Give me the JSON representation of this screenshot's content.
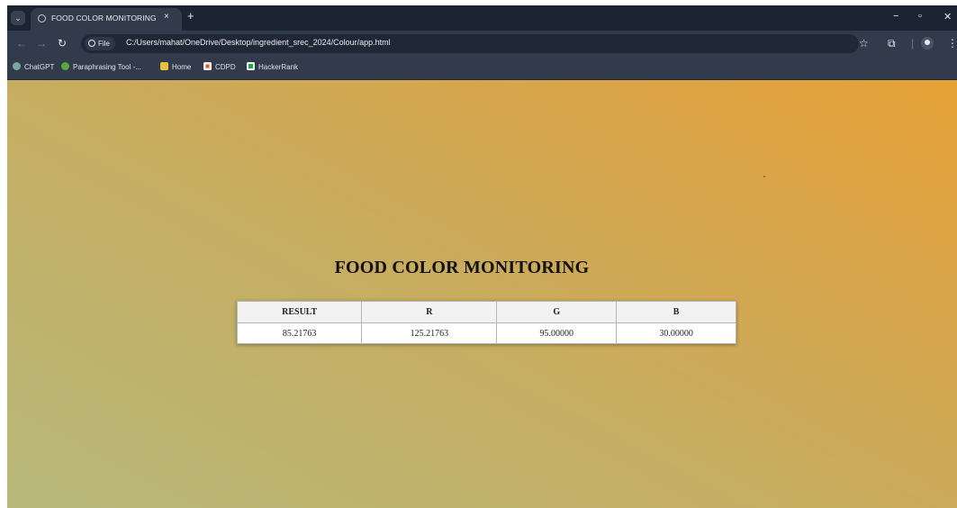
{
  "browser": {
    "tab_title": "FOOD COLOR MONITORING",
    "tab_close": "×",
    "new_tab": "+",
    "omnibox": {
      "info_label": "File",
      "url": "C:/Users/mahat/OneDrive/Desktop/ingredient_srec_2024/Colour/app.html"
    },
    "bookmarks": [
      {
        "label": "ChatGPT",
        "color": "#74aa9c"
      },
      {
        "label": "Paraphrasing Tool -...",
        "color": "#5da545"
      },
      {
        "label": "Home",
        "color": "#e8c33a"
      },
      {
        "label": "CDPD",
        "color": "#f2f2f2"
      },
      {
        "label": "HackerRank",
        "color": "#1ba94c"
      }
    ]
  },
  "page": {
    "heading": "FOOD COLOR MONITORING",
    "table": {
      "headers": [
        "RESULT",
        "R",
        "G",
        "B"
      ],
      "row": [
        "85.21763",
        "125.21763",
        "95.00000",
        "30.00000"
      ]
    }
  },
  "colors": {
    "tabstrip_bg": "#1c2331",
    "toolbar_bg": "#323b4b",
    "gradient_start": "#b7b87a",
    "gradient_end": "#e6a236"
  }
}
